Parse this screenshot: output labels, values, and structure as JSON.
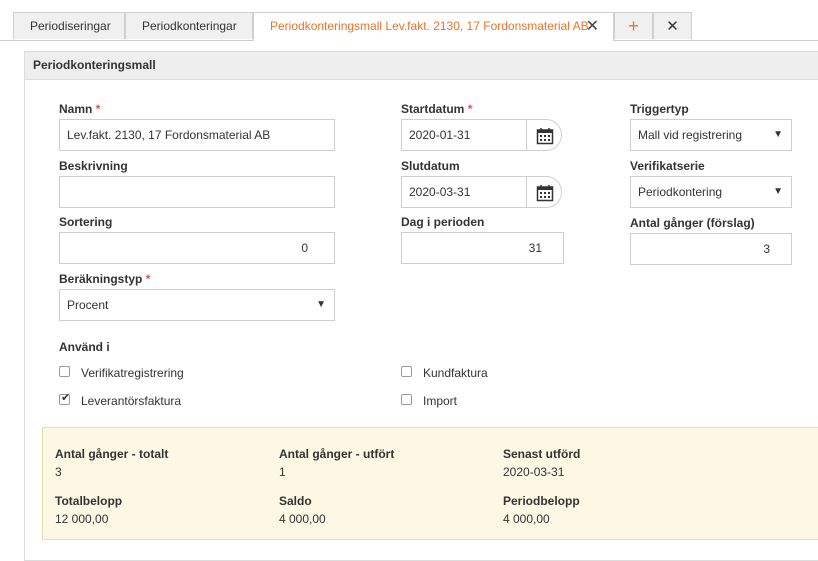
{
  "tabs": [
    {
      "label": "Periodiseringar"
    },
    {
      "label": "Periodkonteringar"
    },
    {
      "label": "Periodkonteringsmall Lev.fakt. 2130, 17 Fordonsmaterial AB"
    }
  ],
  "tab_icons": {
    "close": "✕",
    "add": "+",
    "close_all": "✕"
  },
  "panel_title": "Periodkonteringsmall",
  "form": {
    "name_label": "Namn",
    "name_value": "Lev.fakt. 2130, 17 Fordonsmaterial AB",
    "description_label": "Beskrivning",
    "description_value": "",
    "sort_label": "Sortering",
    "sort_value": "0",
    "calc_type_label": "Beräkningstyp",
    "calc_type_value": "Procent",
    "start_label": "Startdatum",
    "start_value": "2020-01-31",
    "end_label": "Slutdatum",
    "end_value": "2020-03-31",
    "day_label": "Dag i perioden",
    "day_value": "31",
    "trigger_label": "Triggertyp",
    "trigger_value": "Mall vid registrering",
    "series_label": "Verifikatserie",
    "series_value": "Periodkontering",
    "count_label": "Antal gånger (förslag)",
    "count_value": "3",
    "required_mark": "*"
  },
  "use_in": {
    "label": "Använd i",
    "items": [
      {
        "label": "Verifikatregistrering",
        "checked": false
      },
      {
        "label": "Leverantörsfaktura",
        "checked": true
      },
      {
        "label": "Kundfaktura",
        "checked": false
      },
      {
        "label": "Import",
        "checked": false
      }
    ]
  },
  "summary": {
    "total_count_label": "Antal gånger - totalt",
    "total_count_value": "3",
    "done_count_label": "Antal gånger - utfört",
    "done_count_value": "1",
    "last_done_label": "Senast utförd",
    "last_done_value": "2020-03-31",
    "total_amount_label": "Totalbelopp",
    "total_amount_value": "12 000,00",
    "balance_label": "Saldo",
    "balance_value": "4 000,00",
    "period_amount_label": "Periodbelopp",
    "period_amount_value": "4 000,00"
  },
  "colors": {
    "accent": "#e8742a",
    "required": "#d9534f",
    "summary_bg": "#fcf8e3"
  }
}
